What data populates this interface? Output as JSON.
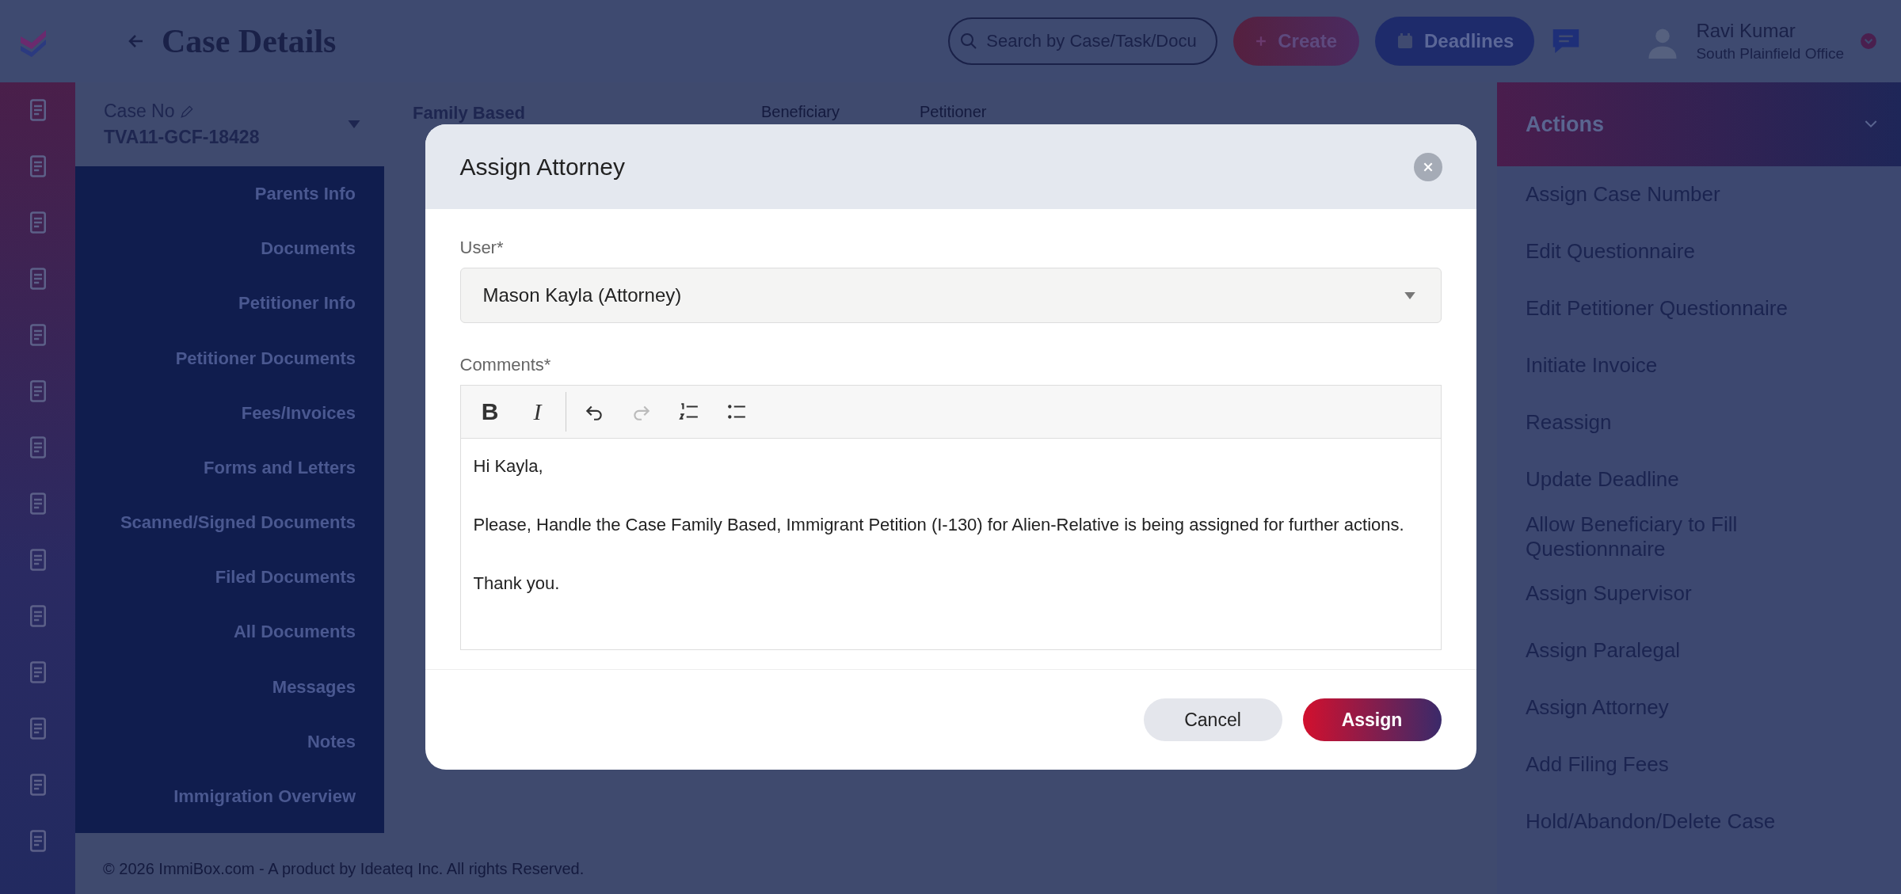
{
  "header": {
    "title": "Case Details",
    "search": {
      "placeholder": "Search by Case/Task/Docu"
    },
    "create_button": "Create",
    "deadlines_button": "Deadlines",
    "user": {
      "name": "Ravi Kumar",
      "office": "South Plainfield Office"
    }
  },
  "case_panel": {
    "label": "Case No",
    "case_number": "TVA11-GCF-18428",
    "menu": [
      "Parents Info",
      "Documents",
      "Petitioner Info",
      "Petitioner Documents",
      "Fees/Invoices",
      "Forms and Letters",
      "Scanned/Signed Documents",
      "Filed Documents",
      "All Documents",
      "Messages",
      "Notes",
      "Immigration Overview"
    ]
  },
  "content": {
    "columns": [
      "Family Based",
      "Beneficiary",
      "Petitioner"
    ]
  },
  "actions": {
    "title": "Actions",
    "items": [
      "Assign Case Number",
      "Edit Questionnaire",
      "Edit Petitioner Questionnaire",
      "Initiate Invoice",
      "Reassign",
      "Update Deadline",
      "Allow Beneficiary to Fill Questionnnaire",
      "Assign Supervisor",
      "Assign Paralegal",
      "Assign Attorney",
      "Add Filing Fees",
      "Hold/Abandon/Delete Case"
    ]
  },
  "footer": "© 2026 ImmiBox.com - A product by Ideateq Inc. All rights Reserved.",
  "modal": {
    "title": "Assign Attorney",
    "user_label": "User*",
    "user_value": "Mason Kayla (Attorney)",
    "comments_label": "Comments*",
    "toolbar": [
      {
        "kind": "bold",
        "label": "B",
        "disabled": false
      },
      {
        "kind": "italic",
        "label": "I",
        "disabled": false
      },
      {
        "kind": "undo",
        "disabled": false
      },
      {
        "kind": "redo",
        "disabled": true
      },
      {
        "kind": "ordered-list",
        "disabled": false
      },
      {
        "kind": "bullet-list",
        "disabled": false
      }
    ],
    "comment_paragraphs": [
      "Hi Kayla,",
      "Please, Handle the Case Family Based, Immigrant Petition (I-130) for Alien-Relative is being assigned for further actions.",
      "Thank you."
    ],
    "buttons": [
      {
        "label": "Cancel",
        "kind": "secondary"
      },
      {
        "label": "Assign",
        "kind": "primary"
      }
    ]
  }
}
